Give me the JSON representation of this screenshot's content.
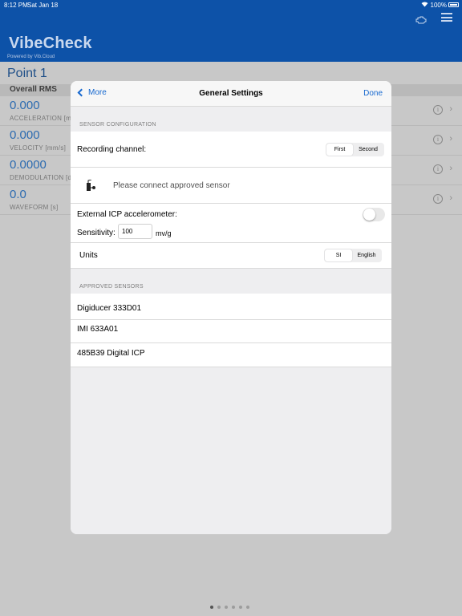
{
  "status": {
    "time": "8:12 PM",
    "date": "Sat Jan 18",
    "battery": "100%"
  },
  "app": {
    "title": "VibeCheck",
    "powered_by": "Powered by Vib.Cloud"
  },
  "point": {
    "title": "Point 1",
    "overall_label": "Overall RMS"
  },
  "metrics": [
    {
      "value": "0.000",
      "label": "ACCELERATION [m/"
    },
    {
      "value": "0.000",
      "label": "VELOCITY [mm/s]"
    },
    {
      "value": "0.0000",
      "label": "DEMODULATION [d"
    },
    {
      "value": "0.0",
      "label": "WAVEFORM [s]"
    }
  ],
  "modal": {
    "back_label": "More",
    "title": "General Settings",
    "done_label": "Done",
    "sensor_config_header": "SENSOR CONFIGURATION",
    "recording_channel_label": "Recording channel:",
    "channel_options": [
      "First",
      "Second"
    ],
    "channel_selected": "First",
    "connect_message": "Please connect approved sensor",
    "external_icp_label": "External ICP accelerometer:",
    "external_icp_on": false,
    "sensitivity_label": "Sensitivity:",
    "sensitivity_value": "100",
    "sensitivity_unit": "mv/g",
    "units_label": "Units",
    "unit_options": [
      "SI",
      "English"
    ],
    "unit_selected": "SI",
    "approved_header": "APPROVED SENSORS",
    "approved_sensors": [
      "Digiducer 333D01",
      "IMI 633A01",
      "485B39 Digital ICP"
    ]
  },
  "pager": {
    "pages": 6,
    "current": 1
  }
}
